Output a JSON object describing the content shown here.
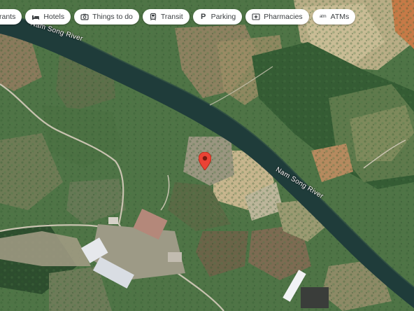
{
  "map": {
    "view": "satellite",
    "chips": [
      {
        "label": "rants",
        "icon": "restaurant-icon"
      },
      {
        "label": "Hotels",
        "icon": "bed-icon"
      },
      {
        "label": "Things to do",
        "icon": "camera-icon"
      },
      {
        "label": "Transit",
        "icon": "tram-icon"
      },
      {
        "label": "Parking",
        "icon": "parking-icon"
      },
      {
        "label": "Pharmacies",
        "icon": "pharmacy-icon"
      },
      {
        "label": "ATMs",
        "icon": "atm-icon"
      }
    ],
    "river_labels": [
      "Nam Song River",
      "Nam Song River"
    ],
    "marker": {
      "icon": "map-pin-icon",
      "color": "#ea4335"
    },
    "colors": {
      "river": "#1f3c3a",
      "vegetation": "#3f6b3b",
      "farmland": "#a7a379"
    }
  }
}
